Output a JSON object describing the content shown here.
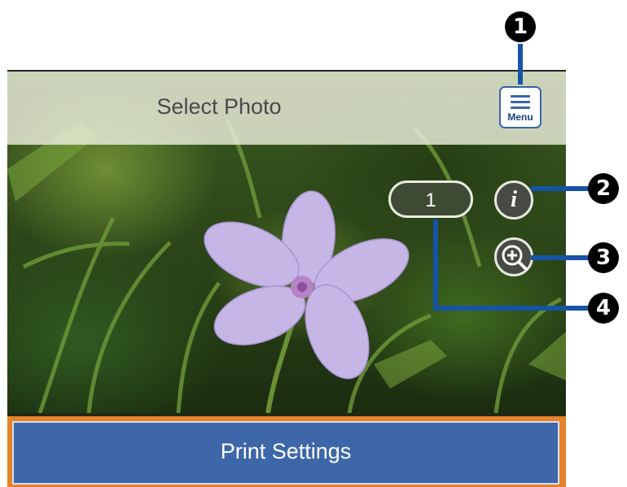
{
  "header": {
    "title": "Select Photo"
  },
  "menu_button": {
    "label": "Menu",
    "icon": "menu-icon"
  },
  "photo_counter": {
    "value": "1"
  },
  "info_button": {
    "label": "i",
    "icon": "info-icon"
  },
  "zoom_button": {
    "icon": "zoom-in-icon"
  },
  "print_settings": {
    "label": "Print Settings"
  },
  "callouts": [
    "1",
    "2",
    "3",
    "4"
  ],
  "colors": {
    "callout": "#1653a4",
    "button_blue": "#3d67a9",
    "button_border_orange": "#e6822a",
    "header_text": "#4a4a4a"
  }
}
